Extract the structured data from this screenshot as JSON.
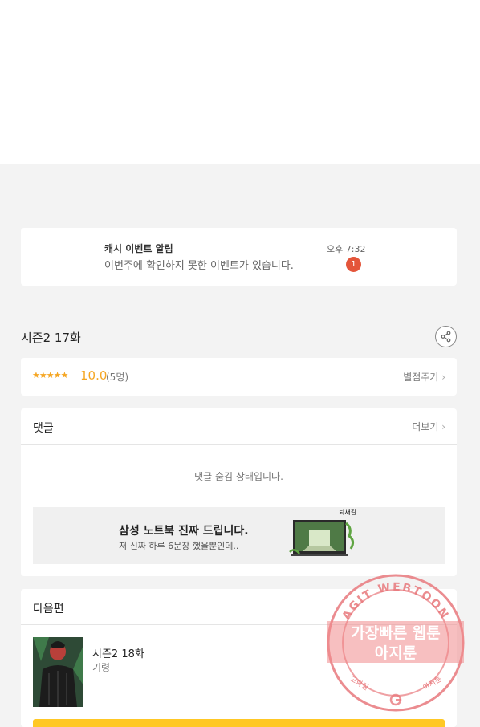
{
  "notification": {
    "title": "캐시 이벤트 알림",
    "message": "이번주에 확인하지 못한 이벤트가 있습니다.",
    "time": "오후 7:32",
    "badge_count": "1"
  },
  "episode": {
    "title": "시즌2 17화",
    "share_icon": "share-icon"
  },
  "rating": {
    "stars": "★★★★★",
    "score": "10.0",
    "voters": "(5명)",
    "rate_link": "별점주기"
  },
  "comments": {
    "title": "댓글",
    "more": "더보기",
    "hidden_message": "댓글 숨김 상태입니다."
  },
  "ad": {
    "title": "삼성 노트북 진짜 드립니다.",
    "subtitle": "저 신짜 하루 6문장 했을뿐인데..",
    "image_label": "퇴채길"
  },
  "next_episode": {
    "section_title": "다음편",
    "name": "시즌2 18화",
    "meta": "기령"
  },
  "watermark": {
    "top_text": "AGIT WEBTOON",
    "line1": "가장빠른 웹툰",
    "line2": "아지툰",
    "bottom_left": "고화질",
    "bottom_right": "아지툰"
  },
  "colors": {
    "accent_star": "#f5a623",
    "badge": "#e4553a",
    "next_button": "#ffc825",
    "watermark": "#e8787c"
  }
}
